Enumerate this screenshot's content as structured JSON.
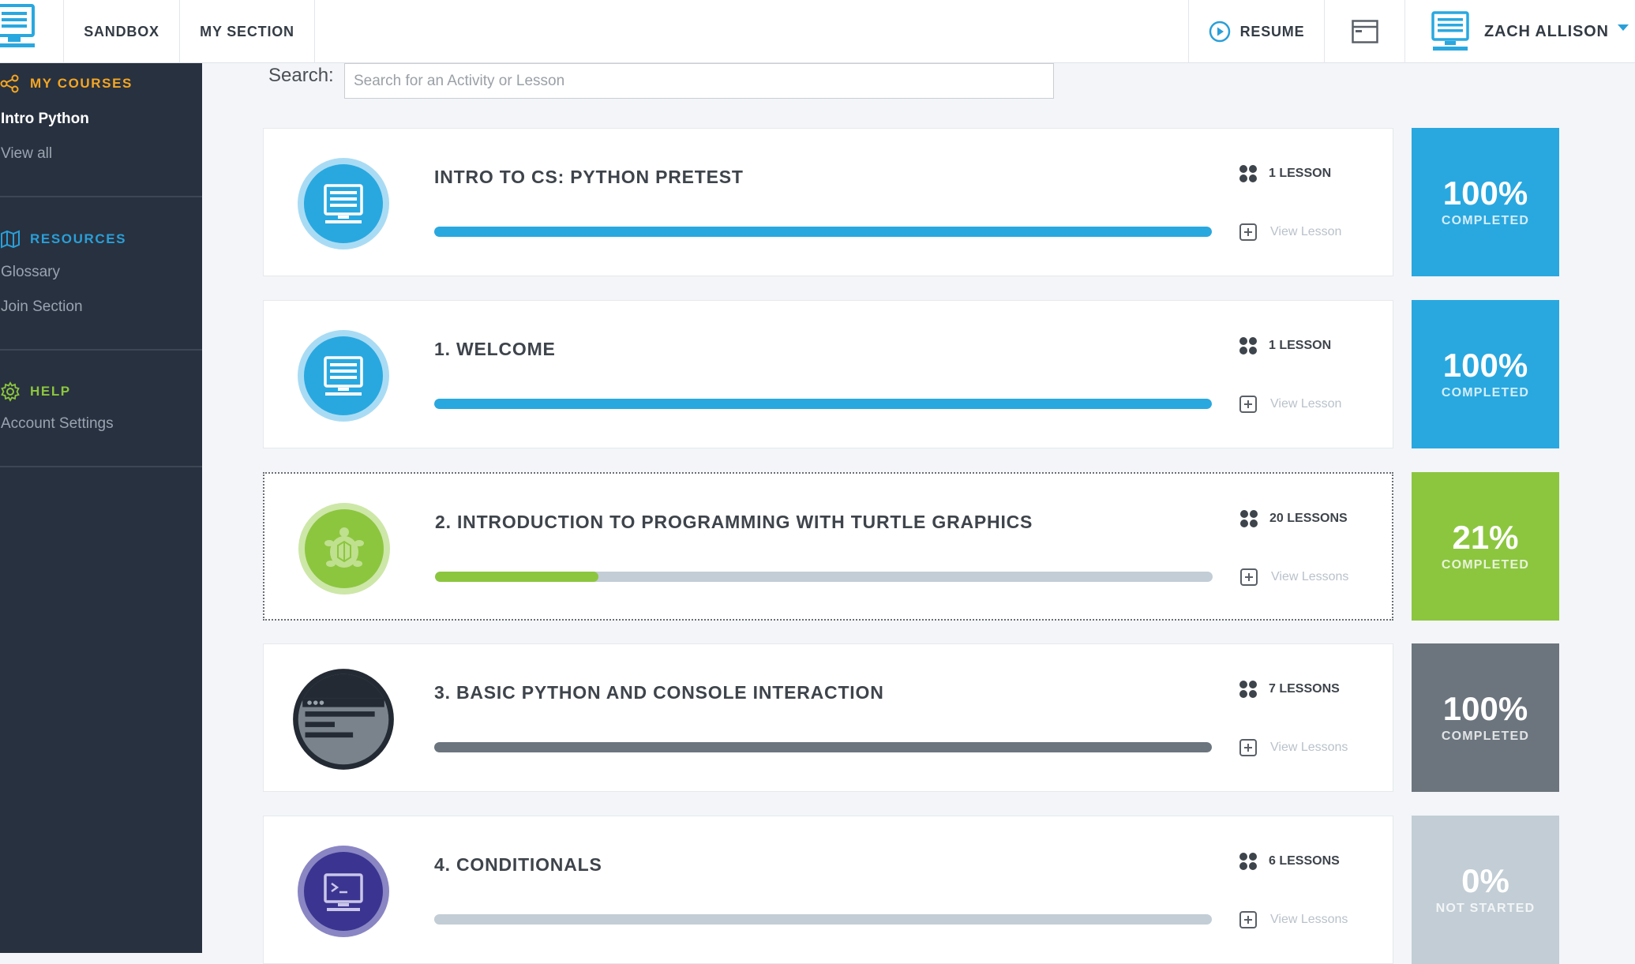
{
  "nav": {
    "sandbox": "SANDBOX",
    "my_section": "MY SECTION",
    "resume": "RESUME",
    "user_name": "ZACH ALLISON"
  },
  "sidebar": {
    "my_courses": {
      "heading": "MY COURSES",
      "items": [
        "Intro Python",
        "View all"
      ]
    },
    "resources": {
      "heading": "RESOURCES",
      "items": [
        "Glossary",
        "Join Section"
      ]
    },
    "help": {
      "heading": "HELP",
      "items": [
        "Account Settings"
      ]
    }
  },
  "search": {
    "label": "Search:",
    "placeholder": "Search for an Activity or Lesson"
  },
  "colors": {
    "blue": "#29a8e0",
    "green": "#8cc63f",
    "gray": "#6c757e",
    "light_gray": "#c2cdd5",
    "purple": "#3b3591",
    "orange": "#f5a623"
  },
  "courses": [
    {
      "title": "INTRO TO CS: PYTHON PRETEST",
      "lessons": "1 LESSON",
      "view": "View Lesson",
      "progress": 1.0,
      "percent": "100%",
      "status": "COMPLETED",
      "icon": "monitor-icon"
    },
    {
      "title": "1. WELCOME",
      "lessons": "1 LESSON",
      "view": "View Lesson",
      "progress": 1.0,
      "percent": "100%",
      "status": "COMPLETED",
      "icon": "monitor-icon"
    },
    {
      "title": "2. INTRODUCTION TO PROGRAMMING WITH TURTLE GRAPHICS",
      "lessons": "20 LESSONS",
      "view": "View Lessons",
      "progress": 0.21,
      "percent": "21%",
      "status": "COMPLETED",
      "icon": "turtle-icon"
    },
    {
      "title": "3. BASIC PYTHON AND CONSOLE INTERACTION",
      "lessons": "7 LESSONS",
      "view": "View Lessons",
      "progress": 1.0,
      "percent": "100%",
      "status": "COMPLETED",
      "icon": "console-window-icon"
    },
    {
      "title": "4. CONDITIONALS",
      "lessons": "6 LESSONS",
      "view": "View Lessons",
      "progress": 0.0,
      "percent": "0%",
      "status": "NOT STARTED",
      "icon": "terminal-icon"
    }
  ]
}
